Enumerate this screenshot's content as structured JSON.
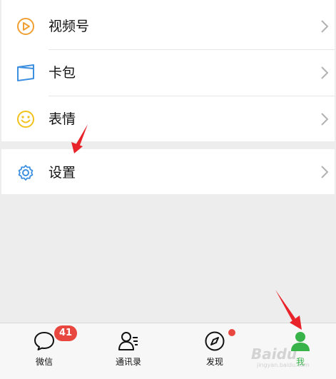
{
  "menu": {
    "channels_label": "视频号",
    "cards_label": "卡包",
    "stickers_label": "表情",
    "settings_label": "设置"
  },
  "tabbar": {
    "tabs": [
      {
        "label": "微信",
        "badge": "41",
        "icon": "chat-bubble-icon"
      },
      {
        "label": "通讯录",
        "icon": "contacts-icon"
      },
      {
        "label": "发现",
        "icon": "compass-icon",
        "dot": true
      },
      {
        "label": "我",
        "icon": "person-icon",
        "active": true
      }
    ]
  },
  "watermark": {
    "brand": "Baidu",
    "sub": "jingyan.baidu.com"
  },
  "colors": {
    "accent_green": "#38b34a",
    "badge_red": "#e8473f",
    "channels_orange": "#f0a032",
    "cards_blue": "#3d8fe0",
    "stickers_yellow": "#f2c21b",
    "settings_blue": "#3d8fe0",
    "annotation_red": "#e8232a"
  }
}
